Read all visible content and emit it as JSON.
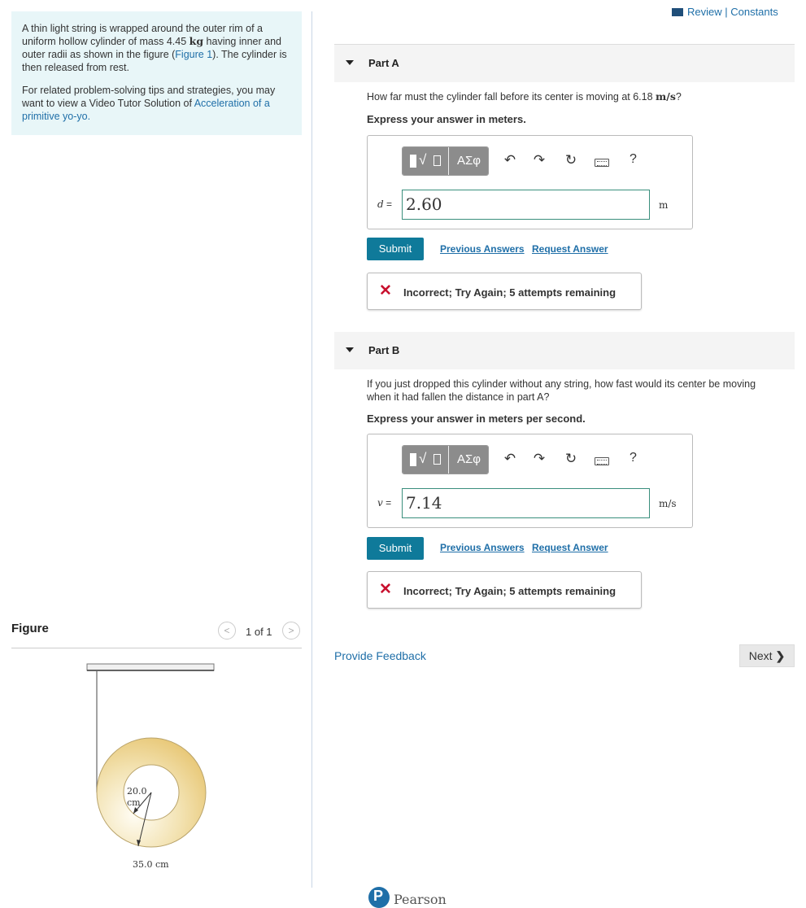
{
  "problem": {
    "para1_a": "A thin light string is wrapped around the outer rim of a uniform hollow cylinder of mass 4.45 ",
    "para1_unit": "kg",
    "para1_b": " having inner and outer radii as shown in the figure (",
    "para1_link": "Figure 1",
    "para1_c": "). The cylinder is then released from rest.",
    "para2_a": "For related problem-solving tips and strategies, you may want to view a Video Tutor Solution of ",
    "para2_link": "Acceleration of a primitive yo-yo."
  },
  "figure": {
    "title": "Figure",
    "page_indicator": "1 of 1",
    "prev_glyph": "<",
    "next_glyph": ">",
    "inner_label_1": "20.0",
    "inner_label_2": "cm",
    "outer_label": "35.0 cm"
  },
  "header": {
    "review_constants": "Review | Constants"
  },
  "part_a": {
    "title": "Part A",
    "question": "How far must the cylinder fall before its center is moving at 6.18 ",
    "question_unit": "m/s",
    "question_end": "?",
    "instruction": "Express your answer in meters.",
    "greek_label": "ΑΣφ",
    "help": "?",
    "variable": "d",
    "equals": "=",
    "value": "2.60",
    "unit": "m",
    "submit": "Submit",
    "previous_answers": "Previous Answers",
    "request_answer": "Request Answer",
    "feedback": "Incorrect; Try Again; 5 attempts remaining"
  },
  "part_b": {
    "title": "Part B",
    "question": "If you just dropped this cylinder without any string, how fast would its center be moving when it had fallen the distance in part A?",
    "instruction": "Express your answer in meters per second.",
    "greek_label": "ΑΣφ",
    "help": "?",
    "variable": "v",
    "equals": "=",
    "value": "7.14",
    "unit": "m/s",
    "submit": "Submit",
    "previous_answers": "Previous Answers",
    "request_answer": "Request Answer",
    "feedback": "Incorrect; Try Again; 5 attempts remaining"
  },
  "footer": {
    "provide_feedback": "Provide Feedback",
    "next": "Next",
    "next_glyph": "❯",
    "pearson": "Pearson",
    "pearson_mark": "P"
  },
  "colors": {
    "accent": "#0f7a9a",
    "link": "#1f6fa8",
    "error": "#c8102e",
    "problem_bg": "#e8f6f8"
  }
}
